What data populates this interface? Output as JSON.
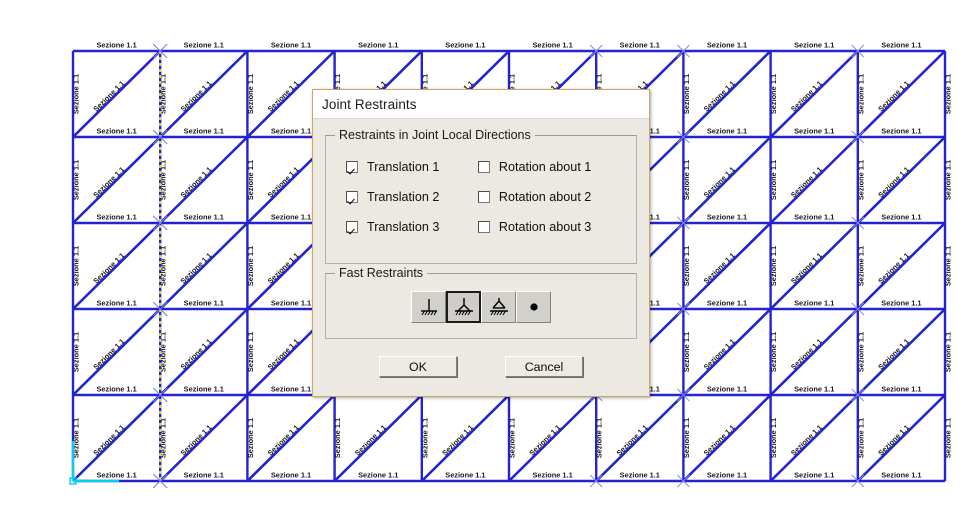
{
  "background": {
    "kind": "structural-frame-model",
    "member_label": "Sezione 1.1",
    "grid": {
      "columns": 10,
      "rows": 5
    },
    "colors": {
      "member": "#2323cf",
      "label": "#1a1a1a",
      "selection_highlight": "#d8d84a",
      "origin_marker": "#00d2f0"
    }
  },
  "dialog": {
    "title": "Joint Restraints",
    "restraints_group": {
      "title": "Restraints in Joint Local Directions",
      "rows": [
        {
          "translation_label": "Translation  1",
          "translation_checked": true,
          "rotation_label": "Rotation about  1",
          "rotation_checked": false
        },
        {
          "translation_label": "Translation  2",
          "translation_checked": true,
          "rotation_label": "Rotation about  2",
          "rotation_checked": false
        },
        {
          "translation_label": "Translation  3",
          "translation_checked": true,
          "rotation_label": "Rotation about  3",
          "rotation_checked": false
        }
      ]
    },
    "fast_group": {
      "title": "Fast Restraints",
      "buttons": [
        {
          "name": "fixed-restraint-icon",
          "selected": false
        },
        {
          "name": "pinned-restraint-icon",
          "selected": true
        },
        {
          "name": "roller-restraint-icon",
          "selected": false
        },
        {
          "name": "free-restraint-icon",
          "selected": false
        }
      ]
    },
    "ok_label": "OK",
    "cancel_label": "Cancel"
  }
}
